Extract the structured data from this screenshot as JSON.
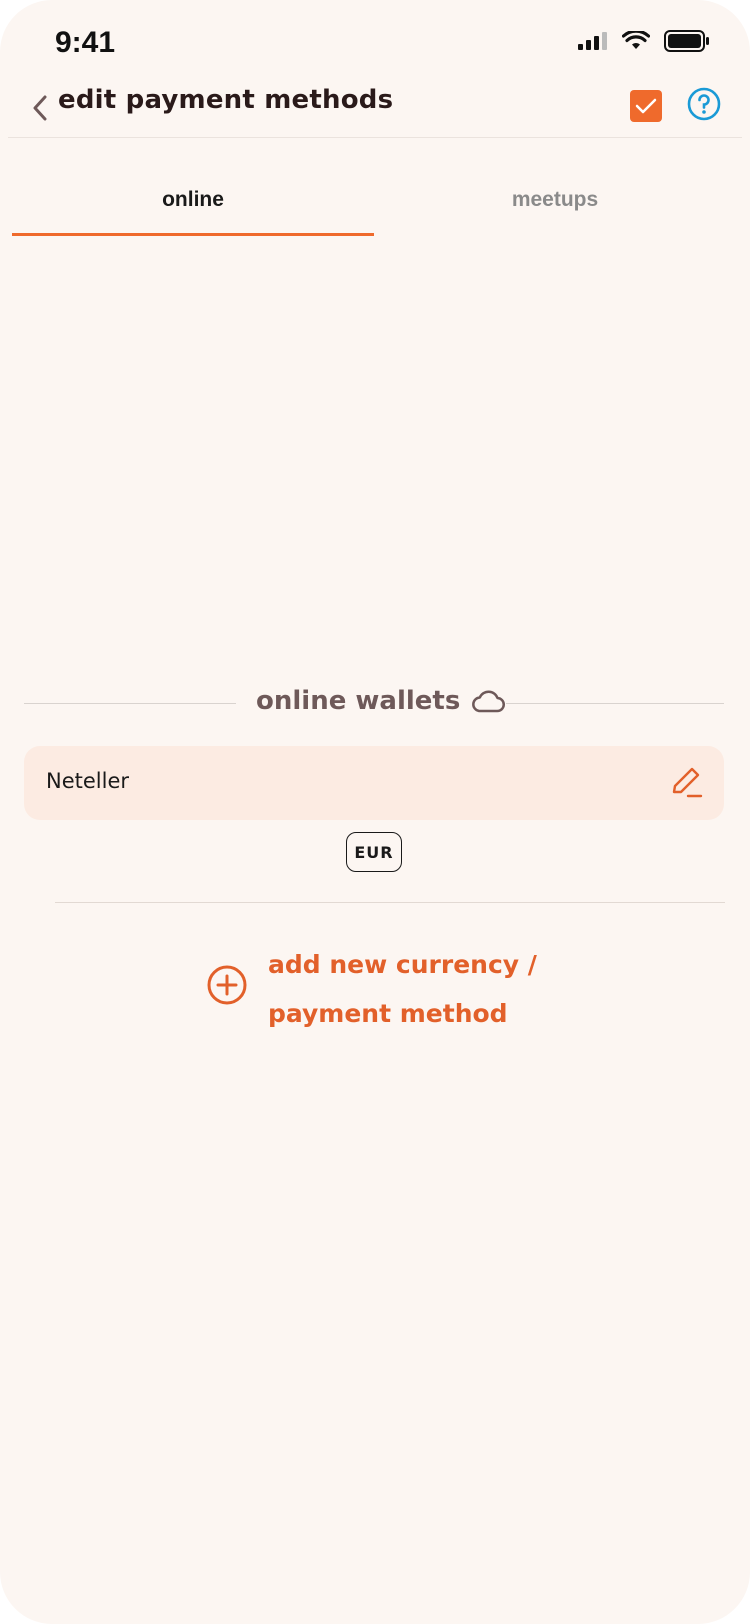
{
  "status_bar": {
    "time": "9:41"
  },
  "header": {
    "title": "edit payment methods"
  },
  "tabs": [
    {
      "label": "online",
      "active": true
    },
    {
      "label": "meetups",
      "active": false
    }
  ],
  "section": {
    "title": "online wallets",
    "icon": "cloud-icon"
  },
  "wallets": [
    {
      "name": "Neteller",
      "currency": "EUR"
    }
  ],
  "add_action": {
    "line1": "add new currency /",
    "line2": "payment method"
  },
  "colors": {
    "accent": "#ef6a2c",
    "help": "#1a9ad6",
    "background": "#fcf6f2",
    "row_background": "#fcebe2"
  }
}
